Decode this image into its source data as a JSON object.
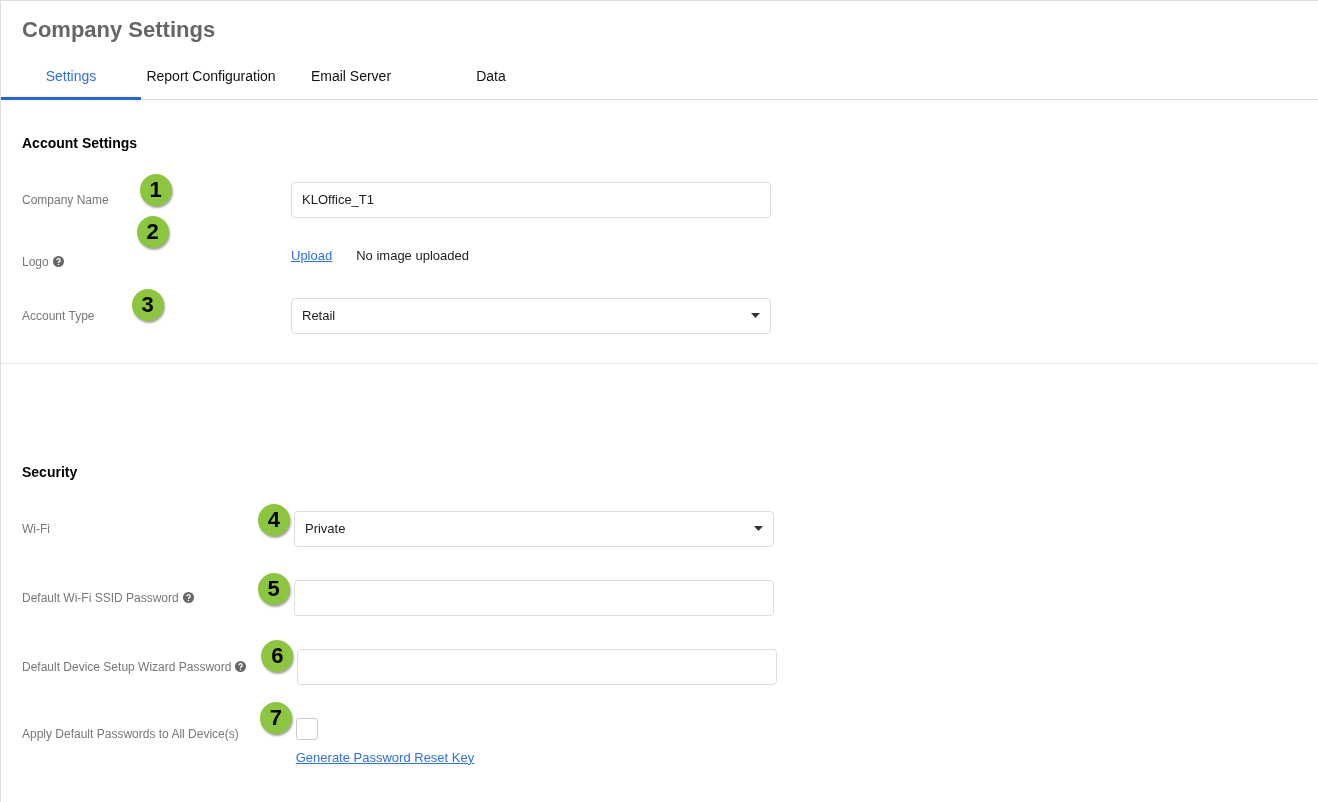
{
  "title": "Company Settings",
  "tabs": [
    {
      "label": "Settings",
      "selected": true
    },
    {
      "label": "Report Configuration",
      "selected": false
    },
    {
      "label": "Email Server",
      "selected": false
    },
    {
      "label": "Data",
      "selected": false
    }
  ],
  "sections": [
    {
      "heading": "Account Settings",
      "rows": [
        {
          "kind": "text",
          "label": "Company Name",
          "help": false,
          "marker": "1",
          "value": "KLOffice_T1"
        },
        {
          "kind": "upload",
          "label": "Logo",
          "help": true,
          "marker": "2",
          "link": "Upload",
          "note": "No image uploaded"
        },
        {
          "kind": "select",
          "label": "Account Type",
          "help": false,
          "marker": "3",
          "value": "Retail"
        }
      ]
    },
    {
      "heading": "Security",
      "rows": [
        {
          "kind": "select",
          "label": "Wi-Fi",
          "help": false,
          "marker": "4",
          "value": "Private"
        },
        {
          "kind": "text",
          "label": "Default Wi-Fi SSID Password",
          "help": true,
          "marker": "5"
        },
        {
          "kind": "text",
          "label": "Default Device Setup Wizard Password",
          "help": true,
          "marker": "6"
        },
        {
          "kind": "checkbox",
          "label": "Apply Default Passwords to All Device(s)",
          "help": false,
          "marker": "7",
          "checked": false,
          "link": "Generate Password Reset Key"
        }
      ]
    }
  ]
}
